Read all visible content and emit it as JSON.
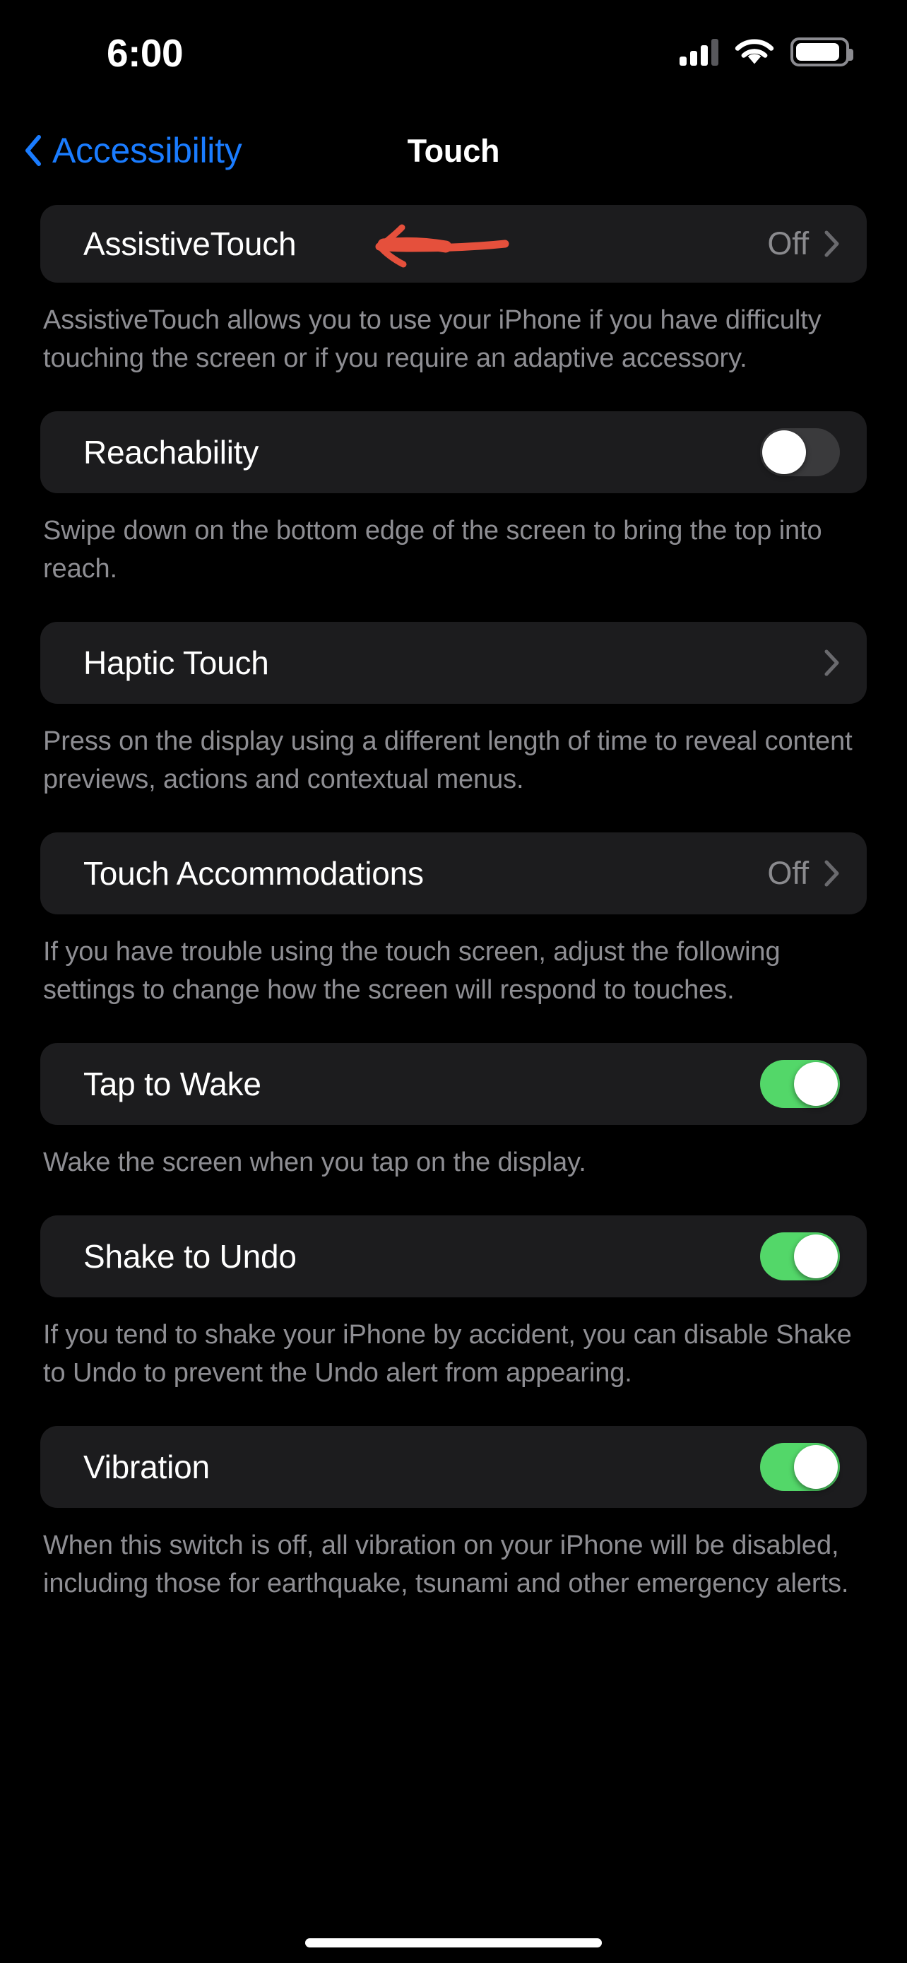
{
  "status_bar": {
    "time": "6:00",
    "cellular_icon": "cellular-signal-icon",
    "cellular_bars_filled": 3,
    "cellular_bars_total": 4,
    "wifi_icon": "wifi-icon",
    "battery_icon": "battery-icon",
    "battery_level_percent": 85
  },
  "nav": {
    "back_label": "Accessibility",
    "back_icon": "chevron-left-icon",
    "title": "Touch"
  },
  "annotation": {
    "type": "hand-drawn-arrow",
    "direction": "left",
    "color": "#e5503c",
    "points_at": "AssistiveTouch"
  },
  "colors": {
    "background": "#000000",
    "card": "#1c1c1e",
    "accent_blue": "#1a7cff",
    "toggle_on": "#53d769",
    "toggle_off": "#3a3a3c",
    "secondary_text": "#8e8e93",
    "annotation_red": "#e5503c"
  },
  "sections": [
    {
      "id": "assistivetouch",
      "title": "AssistiveTouch",
      "control": "disclosure",
      "value": "Off",
      "disclosure_icon": "chevron-right-icon",
      "footer": "AssistiveTouch allows you to use your iPhone if you have difficulty touching the screen or if you require an adaptive accessory."
    },
    {
      "id": "reachability",
      "title": "Reachability",
      "control": "toggle",
      "value": "off",
      "footer": "Swipe down on the bottom edge of the screen to bring the top into reach."
    },
    {
      "id": "haptic-touch",
      "title": "Haptic Touch",
      "control": "disclosure",
      "value": "",
      "disclosure_icon": "chevron-right-icon",
      "footer": "Press on the display using a different length of time to reveal content previews, actions and contextual menus."
    },
    {
      "id": "touch-accommodations",
      "title": "Touch Accommodations",
      "control": "disclosure",
      "value": "Off",
      "disclosure_icon": "chevron-right-icon",
      "footer": "If you have trouble using the touch screen, adjust the following settings to change how the screen will respond to touches."
    },
    {
      "id": "tap-to-wake",
      "title": "Tap to Wake",
      "control": "toggle",
      "value": "on",
      "footer": "Wake the screen when you tap on the display."
    },
    {
      "id": "shake-to-undo",
      "title": "Shake to Undo",
      "control": "toggle",
      "value": "on",
      "footer": "If you tend to shake your iPhone by accident, you can disable Shake to Undo to prevent the Undo alert from appearing."
    },
    {
      "id": "vibration",
      "title": "Vibration",
      "control": "toggle",
      "value": "on",
      "footer": "When this switch is off, all vibration on your iPhone will be disabled, including those for earthquake, tsunami and other emergency alerts."
    }
  ]
}
